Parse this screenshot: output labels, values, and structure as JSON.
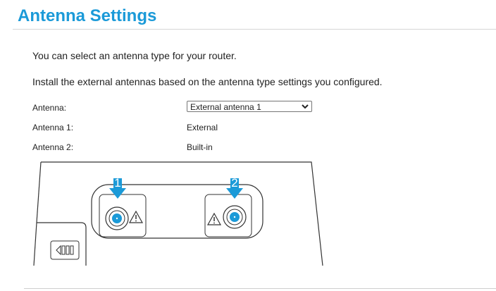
{
  "page": {
    "title": "Antenna Settings"
  },
  "intro": {
    "line1": "You can select an antenna type for your router.",
    "line2": "Install the external antennas based on the antenna type settings you configured."
  },
  "settings": {
    "antenna_label": "Antenna:",
    "antenna_selected": "External antenna 1",
    "antenna1_label": "Antenna 1:",
    "antenna1_value": "External",
    "antenna2_label": "Antenna 2:",
    "antenna2_value": "Built-in"
  },
  "diagram": {
    "port1_number": "1",
    "port2_number": "2",
    "accent_color": "#1b9ad8"
  }
}
